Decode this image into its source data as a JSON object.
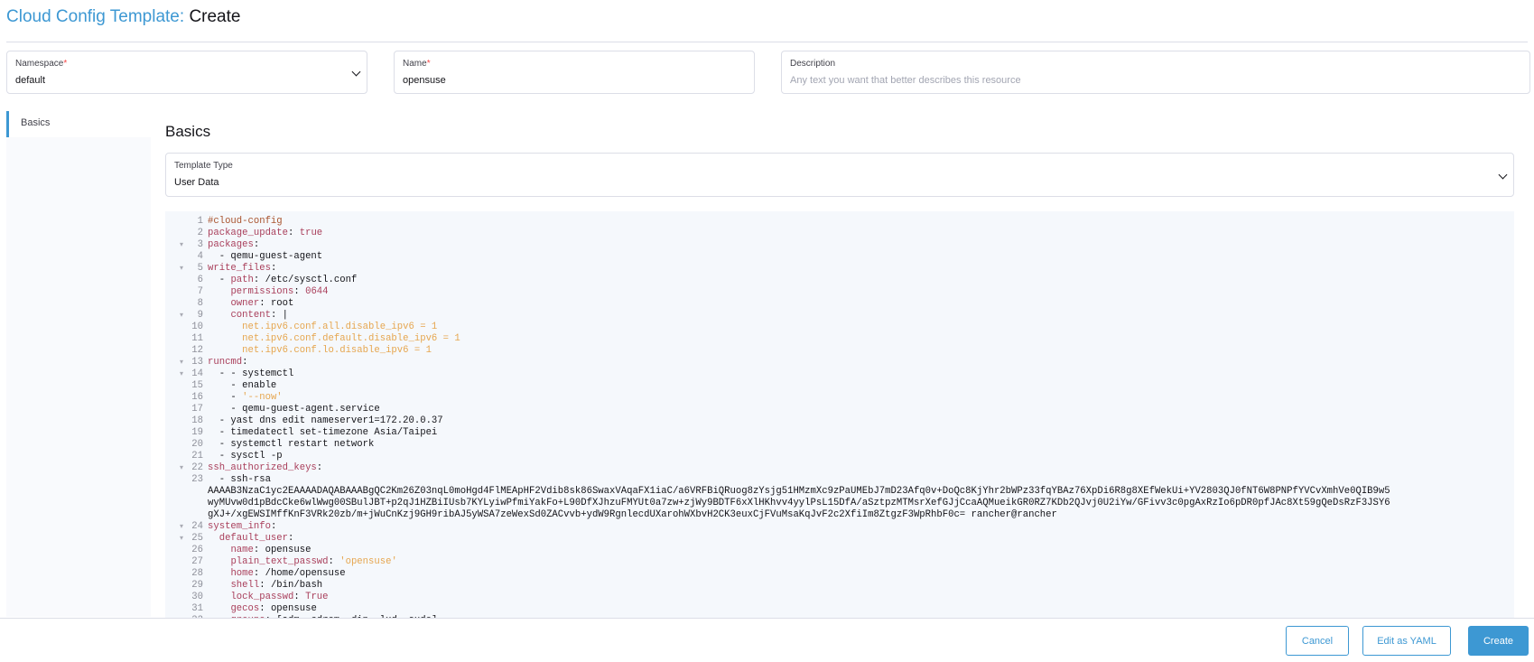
{
  "header": {
    "resource": "Cloud Config Template:",
    "action": "Create"
  },
  "fields": {
    "namespace": {
      "label": "Namespace",
      "value": "default"
    },
    "name": {
      "label": "Name",
      "value": "opensuse"
    },
    "description": {
      "label": "Description",
      "placeholder": "Any text you want that better describes this resource"
    }
  },
  "sidebar": {
    "tab": "Basics"
  },
  "section": {
    "title": "Basics",
    "template_type": {
      "label": "Template Type",
      "value": "User Data"
    }
  },
  "editor": {
    "lines": [
      {
        "n": "1",
        "f": false,
        "t": "#cloud-config"
      },
      {
        "n": "2",
        "f": false,
        "t": "package_update: true"
      },
      {
        "n": "3",
        "f": true,
        "t": "packages:"
      },
      {
        "n": "4",
        "f": false,
        "t": "  - qemu-guest-agent"
      },
      {
        "n": "5",
        "f": true,
        "t": "write_files:"
      },
      {
        "n": "6",
        "f": false,
        "t": "  - path: /etc/sysctl.conf"
      },
      {
        "n": "7",
        "f": false,
        "t": "    permissions: 0644"
      },
      {
        "n": "8",
        "f": false,
        "t": "    owner: root"
      },
      {
        "n": "9",
        "f": true,
        "t": "    content: |"
      },
      {
        "n": "10",
        "f": false,
        "t": "      net.ipv6.conf.all.disable_ipv6 = 1"
      },
      {
        "n": "11",
        "f": false,
        "t": "      net.ipv6.conf.default.disable_ipv6 = 1"
      },
      {
        "n": "12",
        "f": false,
        "t": "      net.ipv6.conf.lo.disable_ipv6 = 1"
      },
      {
        "n": "13",
        "f": true,
        "t": "runcmd:"
      },
      {
        "n": "14",
        "f": true,
        "t": "  - - systemctl"
      },
      {
        "n": "15",
        "f": false,
        "t": "    - enable"
      },
      {
        "n": "16",
        "f": false,
        "t": "    - '--now'"
      },
      {
        "n": "17",
        "f": false,
        "t": "    - qemu-guest-agent.service"
      },
      {
        "n": "18",
        "f": false,
        "t": "  - yast dns edit nameserver1=172.20.0.37"
      },
      {
        "n": "19",
        "f": false,
        "t": "  - timedatectl set-timezone Asia/Taipei"
      },
      {
        "n": "20",
        "f": false,
        "t": "  - systemctl restart network"
      },
      {
        "n": "21",
        "f": false,
        "t": "  - sysctl -p"
      },
      {
        "n": "22",
        "f": true,
        "t": "ssh_authorized_keys:"
      },
      {
        "n": "23",
        "f": false,
        "t": "  - ssh-rsa"
      },
      {
        "n": "",
        "f": false,
        "t": "AAAAB3NzaC1yc2EAAAADAQABAAABgQC2Km26Z03nqL0moHgd4FlMEApHF2Vdib8sk86SwaxVAqaFX1iaC/a6VRFBiQRuog8zYsjg51HMzmXc9zPaUMEbJ7mD23Afq0v+DoQc8KjYhr2bWPz33fqYBAz76XpDi6R8g8XEfWekUi+YV2803QJ0fNT6W8PNPfYVCvXmhVe0QIB9w5"
      },
      {
        "n": "",
        "f": false,
        "t": "wyMUvw0d1pBdcCke6wlWwg00SBulJBT+p2qJ1HZBiIUsb7KYLyiwPfmiYakFo+L90DfXJhzuFMYUt0a7zw+zjWy9BDTF6xXlHKhvv4yylPsL15DfA/aSztpzMTMsrXefGJjCcaAQMueikGR0RZ7KDb2QJvj0U2iYw/GFivv3c0pgAxRzIo6pDR0pfJAc8Xt59gQeDsRzF3JSY6"
      },
      {
        "n": "",
        "f": false,
        "t": "gXJ+/xgEWSIMffKnF3VRk20zb/m+jWuCnKzj9GH9ribAJ5yWSA7zeWexSd0ZACvvb+ydW9RgnlecdUXarohWXbvH2CK3euxCjFVuMsaKqJvF2c2XfiIm8ZtgzF3WpRhbF0c= rancher@rancher"
      },
      {
        "n": "24",
        "f": true,
        "t": "system_info:"
      },
      {
        "n": "25",
        "f": true,
        "t": "  default_user:"
      },
      {
        "n": "26",
        "f": false,
        "t": "    name: opensuse"
      },
      {
        "n": "27",
        "f": false,
        "t": "    plain_text_passwd: 'opensuse'"
      },
      {
        "n": "28",
        "f": false,
        "t": "    home: /home/opensuse"
      },
      {
        "n": "29",
        "f": false,
        "t": "    shell: /bin/bash"
      },
      {
        "n": "30",
        "f": false,
        "t": "    lock_passwd: True"
      },
      {
        "n": "31",
        "f": false,
        "t": "    gecos: opensuse"
      },
      {
        "n": "32",
        "f": false,
        "t": "    groups: [adm, cdrom, dip, lxd, sudo]"
      }
    ]
  },
  "footer": {
    "cancel": "Cancel",
    "edit_yaml": "Edit as YAML",
    "create": "Create"
  },
  "colors": {
    "accent": "#3d98d3",
    "required": "#f64747",
    "yaml_key": "#a93f5b",
    "yaml_string": "#e6a64f",
    "editor_bg": "#f5f8fc"
  }
}
